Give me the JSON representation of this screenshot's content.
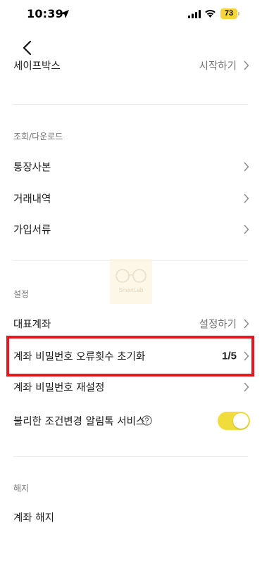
{
  "status_bar": {
    "time": "10:39",
    "battery": "73",
    "battery_color": "#f5d53a"
  },
  "nav": {
    "back_icon": "chevron-left-icon"
  },
  "cut_row": {
    "label": "세이프박스",
    "value": "시작하기"
  },
  "sections": {
    "inquiry": {
      "header": "조회/다운로드",
      "items": [
        {
          "label": "통장사본"
        },
        {
          "label": "거래내역"
        },
        {
          "label": "가입서류"
        }
      ]
    },
    "settings": {
      "header": "설정",
      "representative_account": {
        "label": "대표계좌",
        "value": "설정하기"
      },
      "reset_error_count": {
        "label": "계좌 비밀번호 오류횟수 초기화",
        "value": "1/5"
      },
      "reset_password": {
        "label": "계좌 비밀번호 재설정"
      },
      "alert_service": {
        "label": "불리한 조건변경 알림톡 서비스",
        "toggle_on": true
      }
    },
    "termination": {
      "header": "해지",
      "items": [
        {
          "label": "계좌 해지"
        }
      ]
    }
  },
  "watermark": {
    "text": "SmartLab"
  },
  "colors": {
    "accent_toggle": "#f0dd3c",
    "highlight_border": "#e11a22"
  }
}
